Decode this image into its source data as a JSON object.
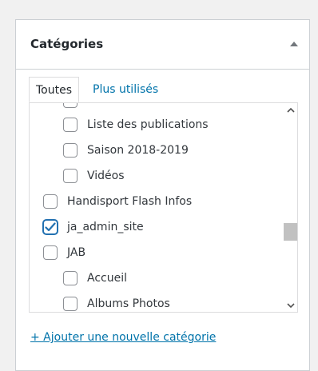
{
  "panel": {
    "title": "Catégories",
    "toggle_icon": "triangle-up-icon"
  },
  "tabs": {
    "all_label": "Toutes",
    "popular_label": "Plus utilisés"
  },
  "categories": [
    {
      "label": "Liste des publications",
      "checked": false,
      "level": 1
    },
    {
      "label": "Saison 2018-2019",
      "checked": false,
      "level": 1
    },
    {
      "label": "Vidéos",
      "checked": false,
      "level": 1
    },
    {
      "label": "Handisport Flash Infos",
      "checked": false,
      "level": 0
    },
    {
      "label": "ja_admin_site",
      "checked": true,
      "level": 0
    },
    {
      "label": "JAB",
      "checked": false,
      "level": 0
    },
    {
      "label": "Accueil",
      "checked": false,
      "level": 1
    },
    {
      "label": "Albums Photos",
      "checked": false,
      "level": 1
    }
  ],
  "add_category_label": "+ Ajouter une nouvelle catégorie",
  "colors": {
    "accent": "#2271b1",
    "link": "#0073aa",
    "border": "#ccd0d4"
  }
}
